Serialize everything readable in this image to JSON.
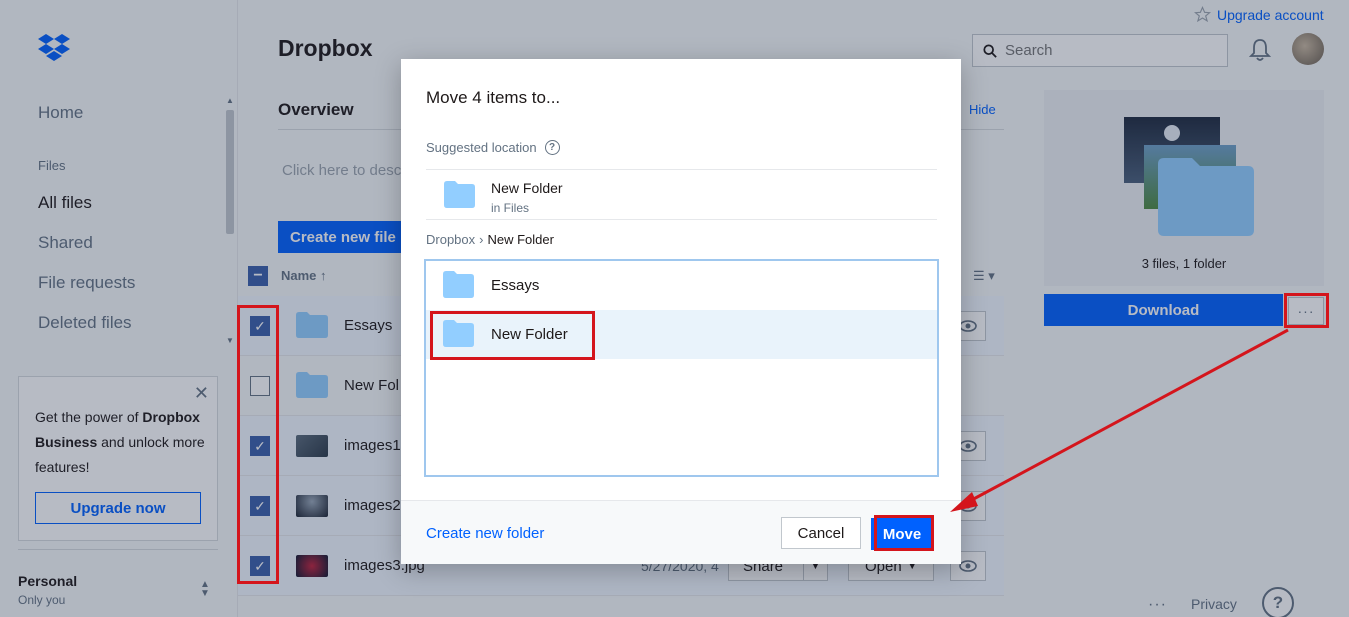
{
  "app": {
    "title": "Dropbox",
    "upgrade_link": "Upgrade account",
    "search_placeholder": "Search"
  },
  "sidebar": {
    "home": "Home",
    "files_section": "Files",
    "all_files": "All files",
    "shared": "Shared",
    "file_requests": "File requests",
    "deleted_files": "Deleted files",
    "promo_line1": "Get the power of",
    "promo_bold": "Dropbox Business",
    "promo_line2": "and unlock more features!",
    "upgrade_button": "Upgrade now",
    "account_name": "Personal",
    "account_sub": "Only you"
  },
  "main": {
    "overview": "Overview",
    "hide": "Hide",
    "describe_placeholder": "Click here to desc",
    "create_file": "Create new file",
    "col_name": "Name",
    "files": [
      {
        "name": "Essays",
        "date": "",
        "share": "",
        "open": "",
        "checked": true
      },
      {
        "name": "New Fol",
        "date": "",
        "share": "",
        "open": "",
        "checked": false
      },
      {
        "name": "images1.",
        "date": "",
        "share": "",
        "open": "",
        "checked": true
      },
      {
        "name": "images2",
        "date": "",
        "share": "",
        "open": "",
        "checked": true
      },
      {
        "name": "images3.jpg",
        "date": "5/27/2020, 4",
        "share": "Share",
        "open": "Open",
        "checked": true
      }
    ]
  },
  "preview": {
    "caption": "3 files, 1 folder",
    "download": "Download",
    "more": "···"
  },
  "footer": {
    "more": "···",
    "privacy": "Privacy",
    "help": "?"
  },
  "modal": {
    "title": "Move 4 items to...",
    "suggested_label": "Suggested location",
    "suggested_name": "New Folder",
    "suggested_sub": "in Files",
    "breadcrumb_root": "Dropbox",
    "breadcrumb_current": "New Folder",
    "folders": [
      {
        "name": "Essays"
      },
      {
        "name": "New Folder"
      }
    ],
    "create_folder": "Create new folder",
    "cancel": "Cancel",
    "move": "Move"
  },
  "colors": {
    "accent": "#0061fe",
    "annotation": "#d4151c",
    "folder": "#92ceff"
  }
}
